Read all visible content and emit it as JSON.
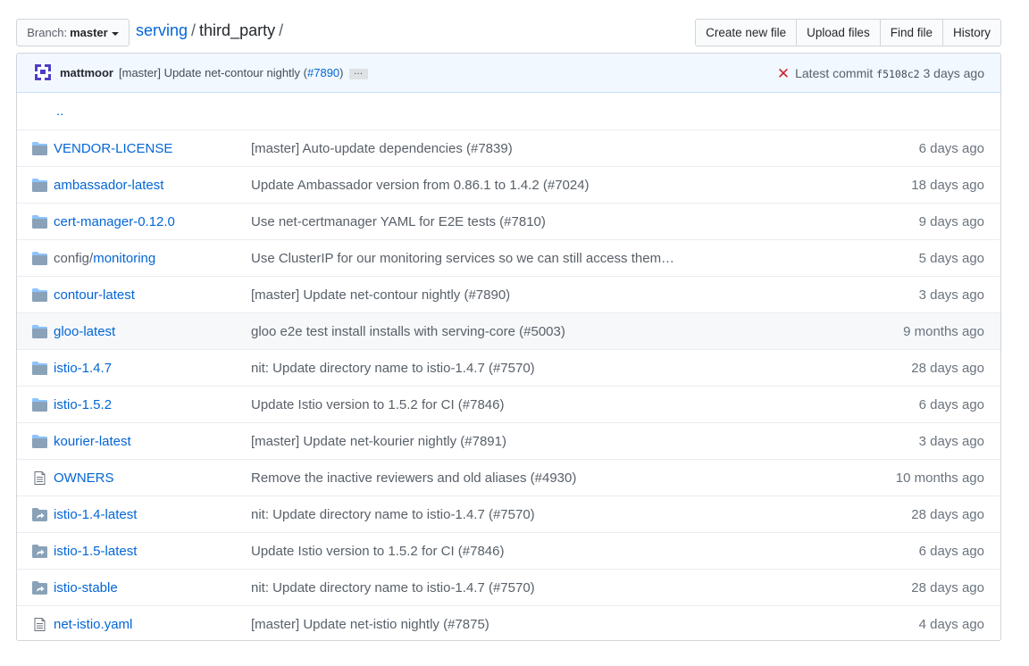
{
  "branch": {
    "label": "Branch:",
    "name": "master"
  },
  "breadcrumb": {
    "repo": "serving",
    "sep1": "/",
    "dir": "third_party",
    "sep2": "/"
  },
  "actions": {
    "create": "Create new file",
    "upload": "Upload files",
    "find": "Find file",
    "history": "History"
  },
  "commit": {
    "author": "mattmoor",
    "message": "[master] Update net-contour nightly (",
    "pr": "#7890",
    "message_end": ")",
    "ellipsis": "…",
    "status_icon": "x-icon",
    "latest_label": "Latest commit",
    "sha": "f5108c2",
    "age": "3 days ago"
  },
  "up_link": "..",
  "files": [
    {
      "type": "dir",
      "name": "VENDOR-LICENSE",
      "prefix": "",
      "message": "[master] Auto-update dependencies (#7839)",
      "age": "6 days ago"
    },
    {
      "type": "dir",
      "name": "ambassador-latest",
      "prefix": "",
      "message": "Update Ambassador version from 0.86.1 to 1.4.2 (#7024)",
      "age": "18 days ago"
    },
    {
      "type": "dir",
      "name": "cert-manager-0.12.0",
      "prefix": "",
      "message": "Use net-certmanager YAML for E2E tests (#7810)",
      "age": "9 days ago"
    },
    {
      "type": "dir",
      "name": "monitoring",
      "prefix": "config/",
      "message": "Use ClusterIP for our monitoring services so we can still access them…",
      "age": "5 days ago"
    },
    {
      "type": "dir",
      "name": "contour-latest",
      "prefix": "",
      "message": "[master] Update net-contour nightly (#7890)",
      "age": "3 days ago"
    },
    {
      "type": "dir",
      "name": "gloo-latest",
      "prefix": "",
      "message": "gloo e2e test install installs with serving-core (#5003)",
      "age": "9 months ago"
    },
    {
      "type": "dir",
      "name": "istio-1.4.7",
      "prefix": "",
      "message": "nit: Update directory name to istio-1.4.7 (#7570)",
      "age": "28 days ago"
    },
    {
      "type": "dir",
      "name": "istio-1.5.2",
      "prefix": "",
      "message": "Update Istio version to 1.5.2 for CI (#7846)",
      "age": "6 days ago"
    },
    {
      "type": "dir",
      "name": "kourier-latest",
      "prefix": "",
      "message": "[master] Update net-kourier nightly (#7891)",
      "age": "3 days ago"
    },
    {
      "type": "file",
      "name": "OWNERS",
      "prefix": "",
      "message": "Remove the inactive reviewers and old aliases (#4930)",
      "age": "10 months ago"
    },
    {
      "type": "symlink",
      "name": "istio-1.4-latest",
      "prefix": "",
      "message": "nit: Update directory name to istio-1.4.7 (#7570)",
      "age": "28 days ago"
    },
    {
      "type": "symlink",
      "name": "istio-1.5-latest",
      "prefix": "",
      "message": "Update Istio version to 1.5.2 for CI (#7846)",
      "age": "6 days ago"
    },
    {
      "type": "symlink",
      "name": "istio-stable",
      "prefix": "",
      "message": "nit: Update directory name to istio-1.4.7 (#7570)",
      "age": "28 days ago"
    },
    {
      "type": "file",
      "name": "net-istio.yaml",
      "prefix": "",
      "message": "[master] Update net-istio nightly (#7875)",
      "age": "4 days ago"
    }
  ],
  "colors": {
    "link": "#0366d6",
    "folder": "#79b8ff",
    "commit_bg": "#f1f8ff",
    "fail": "#cb2431"
  }
}
